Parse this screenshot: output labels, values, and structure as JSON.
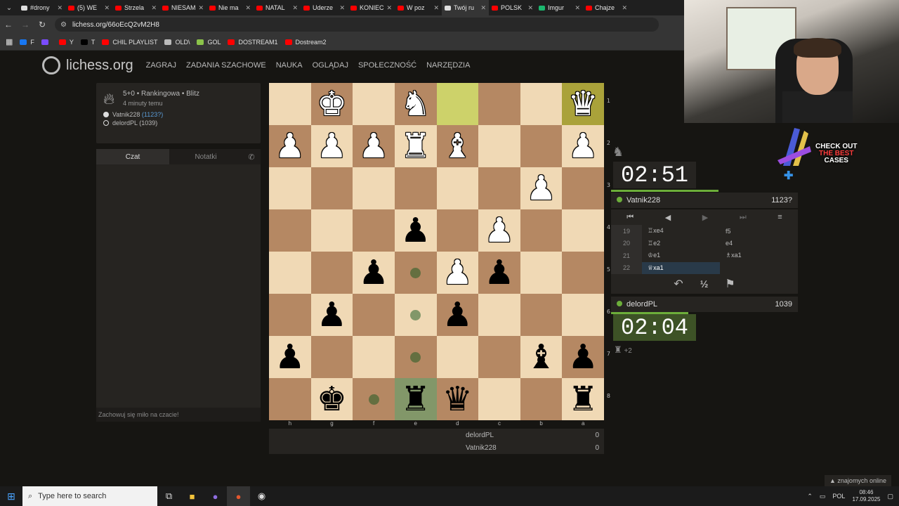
{
  "browser": {
    "tabs": [
      {
        "label": "#drony",
        "color": "#e0e0e0"
      },
      {
        "label": "(5) WE",
        "color": "#ff0000"
      },
      {
        "label": "Strzela",
        "color": "#ff0000"
      },
      {
        "label": "NIESAM",
        "color": "#ff0000"
      },
      {
        "label": "Nie ma",
        "color": "#ff0000"
      },
      {
        "label": "NATAL",
        "color": "#ff0000"
      },
      {
        "label": "Uderze",
        "color": "#ff0000"
      },
      {
        "label": "KONIEC",
        "color": "#ff0000"
      },
      {
        "label": "W poz",
        "color": "#ff0000"
      },
      {
        "label": "Twój ru",
        "color": "#e0e0e0"
      },
      {
        "label": "POLSK",
        "color": "#ff0000"
      },
      {
        "label": "Imgur",
        "color": "#1bb76e"
      },
      {
        "label": "Chajze",
        "color": "#ff0000"
      }
    ],
    "url": "lichess.org/66oEcQ2vM2H8",
    "bookmarks": [
      {
        "label": "F",
        "color": "#1877f2"
      },
      {
        "label": "",
        "color": "#7a4cff"
      },
      {
        "label": "Y",
        "color": "#ff0000"
      },
      {
        "label": "T",
        "color": "#000000"
      },
      {
        "label": "CHIL PLAYLIST",
        "color": "#ff0000"
      },
      {
        "label": "OLD\\",
        "color": "#bbbbbb"
      },
      {
        "label": "GOL",
        "color": "#8bc34a"
      },
      {
        "label": "DOSTREAM1",
        "color": "#ff0000"
      },
      {
        "label": "Dostream2",
        "color": "#ff0000"
      }
    ]
  },
  "site": {
    "logo": "lichess.org",
    "nav": [
      "ZAGRAJ",
      "ZADANIA SZACHOWE",
      "NAUKA",
      "OGLĄDAJ",
      "SPOŁECZNOŚĆ",
      "NARZĘDZIA"
    ]
  },
  "game_info": {
    "title": "5+0 • Rankingowa • Blitz",
    "time_ago": "4 minuty temu",
    "white_player": "Vatnik228",
    "white_rating": "(1123?)",
    "black_player": "delordPL (1039)"
  },
  "chat": {
    "tab_chat": "Czat",
    "tab_notes": "Notatki",
    "placeholder": "Zachowuj się miło na czacie!"
  },
  "board": {
    "ranks": [
      "1",
      "2",
      "3",
      "4",
      "5",
      "6",
      "7",
      "8"
    ],
    "files": [
      "h",
      "g",
      "f",
      "e",
      "d",
      "c",
      "b",
      "a"
    ],
    "rows": [
      [
        "",
        "♚",
        "",
        "♞",
        "",
        "",
        "",
        "♛"
      ],
      [
        "♟",
        "♟",
        "♟",
        "♜",
        "♝",
        "",
        "",
        "♟"
      ],
      [
        "",
        "",
        "",
        "",
        "",
        "",
        "♟",
        ""
      ],
      [
        "",
        "",
        "",
        "♟",
        "",
        "♟",
        "",
        ""
      ],
      [
        "",
        "",
        "♟",
        "",
        "♟",
        "♟",
        "",
        ""
      ],
      [
        "",
        "♟",
        "",
        "",
        "♟",
        "",
        "",
        ""
      ],
      [
        "♟",
        "",
        "",
        "",
        "",
        "",
        "♝",
        "♟"
      ],
      [
        "",
        "♚",
        "",
        "♜",
        "♛",
        "",
        "",
        "♜"
      ]
    ],
    "colors": [
      [
        "w",
        "w",
        "",
        "w",
        "",
        "",
        "",
        "w"
      ],
      [
        "w",
        "w",
        "w",
        "w",
        "w",
        "",
        "",
        "w"
      ],
      [
        "",
        "",
        "",
        "",
        "",
        "",
        "w",
        ""
      ],
      [
        "",
        "",
        "",
        "b",
        "",
        "w",
        "",
        ""
      ],
      [
        "",
        "",
        "b",
        "",
        "w",
        "b",
        "",
        ""
      ],
      [
        "",
        "b",
        "",
        "",
        "b",
        "",
        "",
        ""
      ],
      [
        "b",
        "",
        "",
        "",
        "",
        "",
        "b",
        "b"
      ],
      [
        "",
        "b",
        "",
        "b",
        "b",
        "",
        "",
        "b"
      ]
    ]
  },
  "scores": [
    {
      "name": "delordPL",
      "score": "0"
    },
    {
      "name": "Vatnik228",
      "score": "0"
    }
  ],
  "clocks": {
    "top": "02:51",
    "bottom": "02:04"
  },
  "players": {
    "top_name": "Vatnik228",
    "top_rating": "1123?",
    "bottom_name": "delordPL",
    "bottom_rating": "1039",
    "material_diff": "+2"
  },
  "moves": [
    {
      "num": "19",
      "white": "♖xe4",
      "black": "f5"
    },
    {
      "num": "20",
      "white": "♖e2",
      "black": "e4"
    },
    {
      "num": "21",
      "white": "♔e1",
      "black": "♗xa1"
    },
    {
      "num": "22",
      "white": "♕xa1",
      "black": ""
    }
  ],
  "promo": {
    "line1": "CHECK OUT",
    "line2": "THE BEST",
    "line3": "CASES"
  },
  "friends": "▲ znajomych online",
  "taskbar": {
    "search_placeholder": "Type here to search",
    "lang": "POL",
    "time": "08:46",
    "date": "17.09.2025"
  }
}
